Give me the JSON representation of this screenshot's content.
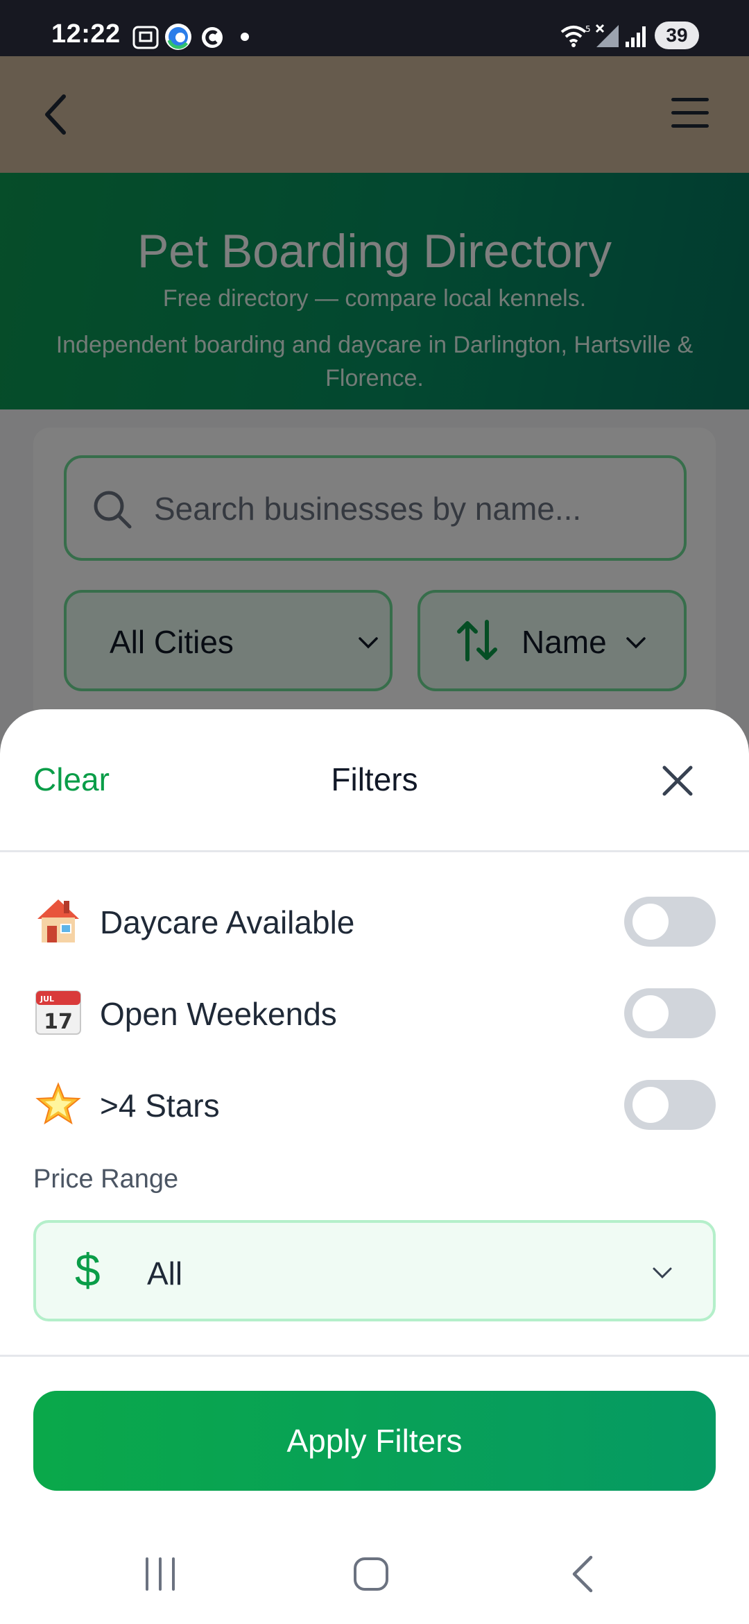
{
  "status_bar": {
    "time": "12:22",
    "battery": "39"
  },
  "app_bar": {
    "back_icon": "chevron-left-icon",
    "menu_icon": "hamburger-menu-icon"
  },
  "hero": {
    "title": "Pet Boarding Directory",
    "subtitle": "Free directory — compare local kennels.",
    "description": "Independent boarding and daycare in Darlington, Hartsville & Florence."
  },
  "search": {
    "placeholder": "Search businesses by name..."
  },
  "filters_bar": {
    "city": "All Cities",
    "sort": "Name"
  },
  "sheet": {
    "clear_label": "Clear",
    "title": "Filters",
    "toggles": [
      {
        "label": "Daycare Available",
        "icon": "house-emoji-icon",
        "on": false
      },
      {
        "label": "Open Weekends",
        "icon": "calendar-emoji-icon",
        "on": false
      },
      {
        "label": ">4 Stars",
        "icon": "glowing-star-emoji-icon",
        "on": false
      }
    ],
    "price_label": "Price Range",
    "price_value": "All",
    "price_icon": "dollar-icon",
    "apply_label": "Apply Filters",
    "calendar_month": "JUL",
    "calendar_day": "17"
  },
  "colors": {
    "accent": "#0a9d48",
    "hero": "#069061",
    "toggle_off": "#d1d5db"
  }
}
